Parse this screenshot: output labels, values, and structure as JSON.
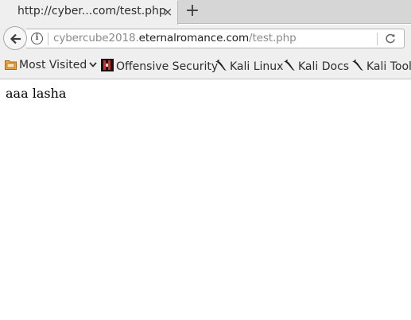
{
  "tab": {
    "title": "http://cyber...com/test.php",
    "close_glyph": "×",
    "new_tab_glyph": "+"
  },
  "navbar": {
    "url_prefix": "cybercube2018.",
    "url_domain": "eternalromance.com",
    "url_path": "/test.php",
    "icons": [
      "back-arrow-icon",
      "info-icon",
      "reload-icon"
    ]
  },
  "bookmarks": [
    {
      "label": "Most Visited",
      "icon": "folder-icon"
    },
    {
      "label": "Offensive Security",
      "icon": "offsec-icon"
    },
    {
      "label": "Kali Linux",
      "icon": "kali-dragon-icon"
    },
    {
      "label": "Kali Docs",
      "icon": "kali-dragon-icon"
    },
    {
      "label": "Kali Tools",
      "icon": "kali-dragon-icon"
    }
  ],
  "page": {
    "text": "aaa lasha"
  }
}
